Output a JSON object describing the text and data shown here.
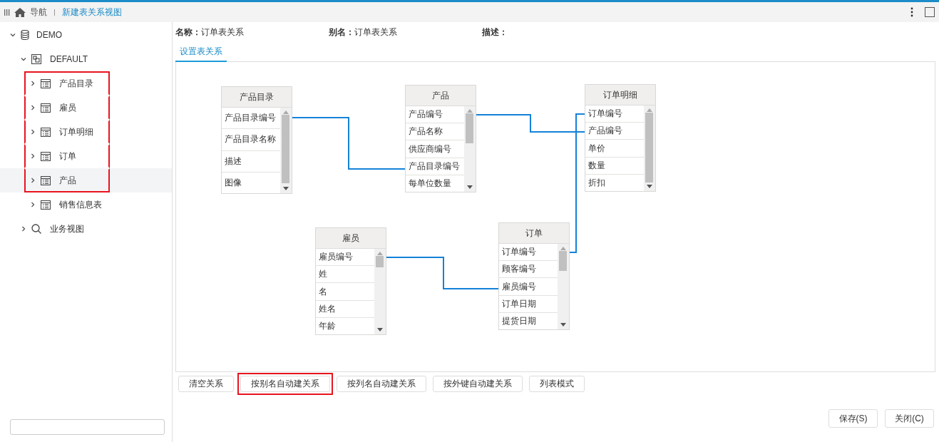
{
  "topbar": {
    "nav_label": "导航",
    "breadcrumb": "新建表关系视图"
  },
  "tree": [
    {
      "label": "DEMO",
      "kind": "database",
      "expanded": true,
      "selected": false,
      "highlighted": false,
      "children": [
        {
          "label": "DEFAULT",
          "kind": "schema",
          "expanded": true,
          "selected": false,
          "highlighted": false,
          "children": [
            {
              "label": "产品目录",
              "kind": "table",
              "expanded": false,
              "selected": false,
              "highlighted": true
            },
            {
              "label": "雇员",
              "kind": "table",
              "expanded": false,
              "selected": false,
              "highlighted": true
            },
            {
              "label": "订单明细",
              "kind": "table",
              "expanded": false,
              "selected": false,
              "highlighted": true
            },
            {
              "label": "订单",
              "kind": "table",
              "expanded": false,
              "selected": false,
              "highlighted": true
            },
            {
              "label": "产品",
              "kind": "table",
              "expanded": false,
              "selected": true,
              "highlighted": true
            },
            {
              "label": "销售信息表",
              "kind": "table",
              "expanded": false,
              "selected": false,
              "highlighted": false
            }
          ]
        },
        {
          "label": "业务视图",
          "kind": "view",
          "expanded": false,
          "selected": false,
          "highlighted": false
        }
      ]
    }
  ],
  "info": [
    {
      "label": "名称：",
      "value": "订单表关系"
    },
    {
      "label": "别名：",
      "value": "订单表关系"
    },
    {
      "label": "描述："
    }
  ],
  "tabs": [
    {
      "label": "设置表关系",
      "selected": true
    }
  ],
  "tables": [
    {
      "name": "产品目录",
      "fields": [
        "产品目录编号",
        "产品目录名称",
        "描述",
        "图像"
      ]
    },
    {
      "name": "产品",
      "fields": [
        "产品编号",
        "产品名称",
        "供应商编号",
        "产品目录编号",
        "每单位数量"
      ]
    },
    {
      "name": "订单明细",
      "fields": [
        "订单编号",
        "产品编号",
        "单价",
        "数量",
        "折扣"
      ]
    },
    {
      "name": "雇员",
      "fields": [
        "雇员编号",
        "姓",
        "名",
        "姓名",
        "年龄"
      ]
    },
    {
      "name": "订单",
      "fields": [
        "订单编号",
        "顾客编号",
        "雇员编号",
        "订单日期",
        "提货日期"
      ]
    }
  ],
  "actions": [
    {
      "label": "清空关系",
      "highlighted": false
    },
    {
      "label": "按别名自动建关系",
      "highlighted": true
    },
    {
      "label": "按列名自动建关系",
      "highlighted": false
    },
    {
      "label": "按外键自动建关系",
      "highlighted": false
    },
    {
      "label": "列表模式",
      "highlighted": false
    }
  ],
  "dialog_buttons": [
    "保存(S)",
    "关闭(C)"
  ]
}
